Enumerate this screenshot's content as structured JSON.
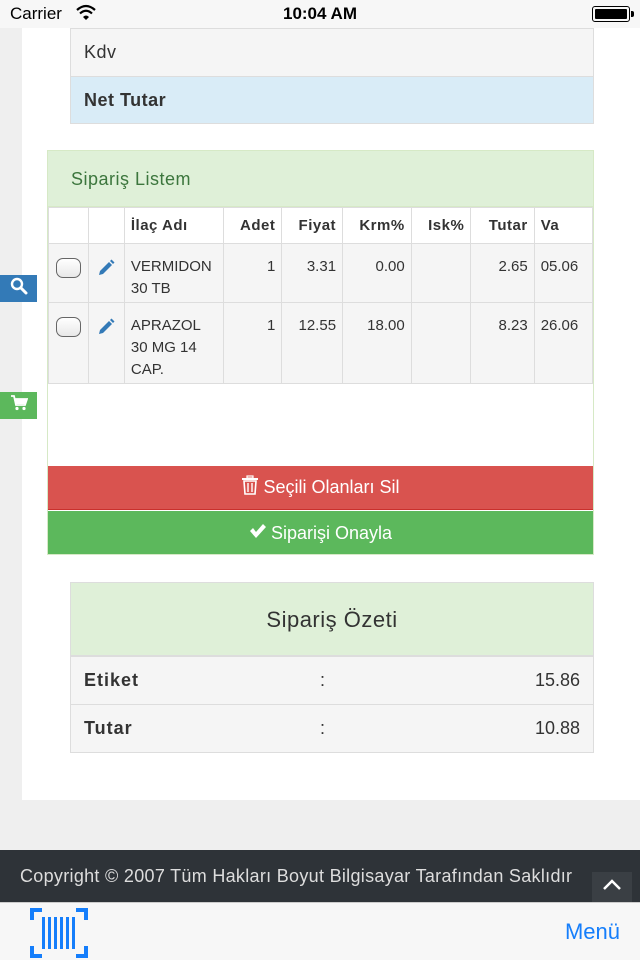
{
  "status_bar": {
    "carrier": "Carrier",
    "time": "10:04 AM"
  },
  "totals": {
    "kdv_label": "Kdv",
    "net_label": "Net Tutar"
  },
  "order_panel": {
    "title": "Sipariş Listem",
    "columns": [
      "İlaç Adı",
      "Adet",
      "Fiyat",
      "Krm%",
      "Isk%",
      "Tutar",
      "Va"
    ],
    "rows": [
      {
        "name": "VERMIDON 30 TB",
        "adet": "1",
        "fiyat": "3.31",
        "krm": "0.00",
        "isk": "",
        "tutar": "2.65",
        "va": "05.06"
      },
      {
        "name": "APRAZOL 30 MG 14 CAP.",
        "adet": "1",
        "fiyat": "12.55",
        "krm": "18.00",
        "isk": "",
        "tutar": "8.23",
        "va": "26.06"
      }
    ],
    "delete_label": "Seçili Olanları Sil",
    "confirm_label": "Siparişi Onayla"
  },
  "summary": {
    "title": "Sipariş Özeti",
    "rows": [
      {
        "label": "Etiket",
        "colon": ":",
        "value": "15.86"
      },
      {
        "label": "Tutar",
        "colon": ":",
        "value": "10.88"
      }
    ]
  },
  "footer": {
    "copyright": "Copyright © 2007 Tüm Hakları Boyut Bilgisayar Tarafından Saklıdır"
  },
  "tabbar": {
    "menu_label": "Menü"
  },
  "icons": [
    "wifi-icon",
    "battery-icon",
    "search-icon",
    "cart-icon",
    "pencil-icon",
    "trash-icon",
    "check-icon",
    "chevron-up-icon",
    "barcode-icon"
  ],
  "colors": {
    "danger": "#d9534f",
    "success": "#5cb85c",
    "primary": "#337ab7",
    "link": "#157efb",
    "info_bg": "#d9ecf7",
    "success_bg": "#dff0d8"
  }
}
